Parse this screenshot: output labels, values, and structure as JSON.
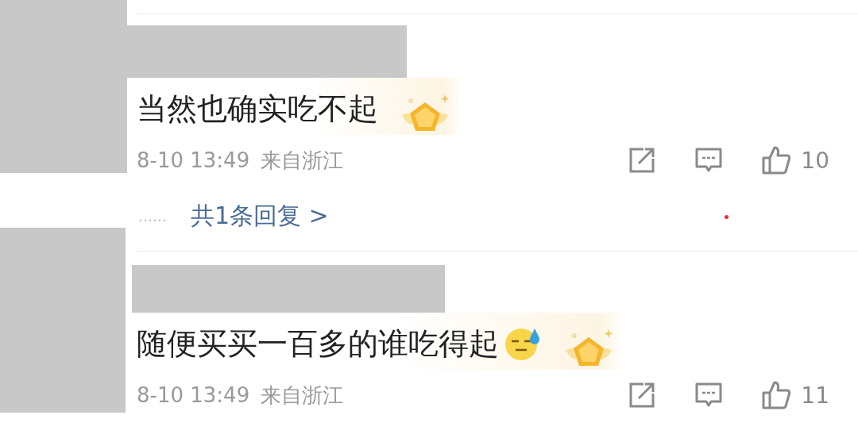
{
  "comments": [
    {
      "text": "当然也确实吃不起",
      "has_emoji": false,
      "has_badge": true,
      "time": "8-10 13:49",
      "location": "来自浙江",
      "likes": "10",
      "more": "……",
      "replies_link": "共1条回复 >"
    },
    {
      "text": "随便买买一百多的谁吃得起",
      "has_emoji": true,
      "has_badge": true,
      "time": "8-10 13:49",
      "location": "来自浙江",
      "likes": "11"
    }
  ]
}
